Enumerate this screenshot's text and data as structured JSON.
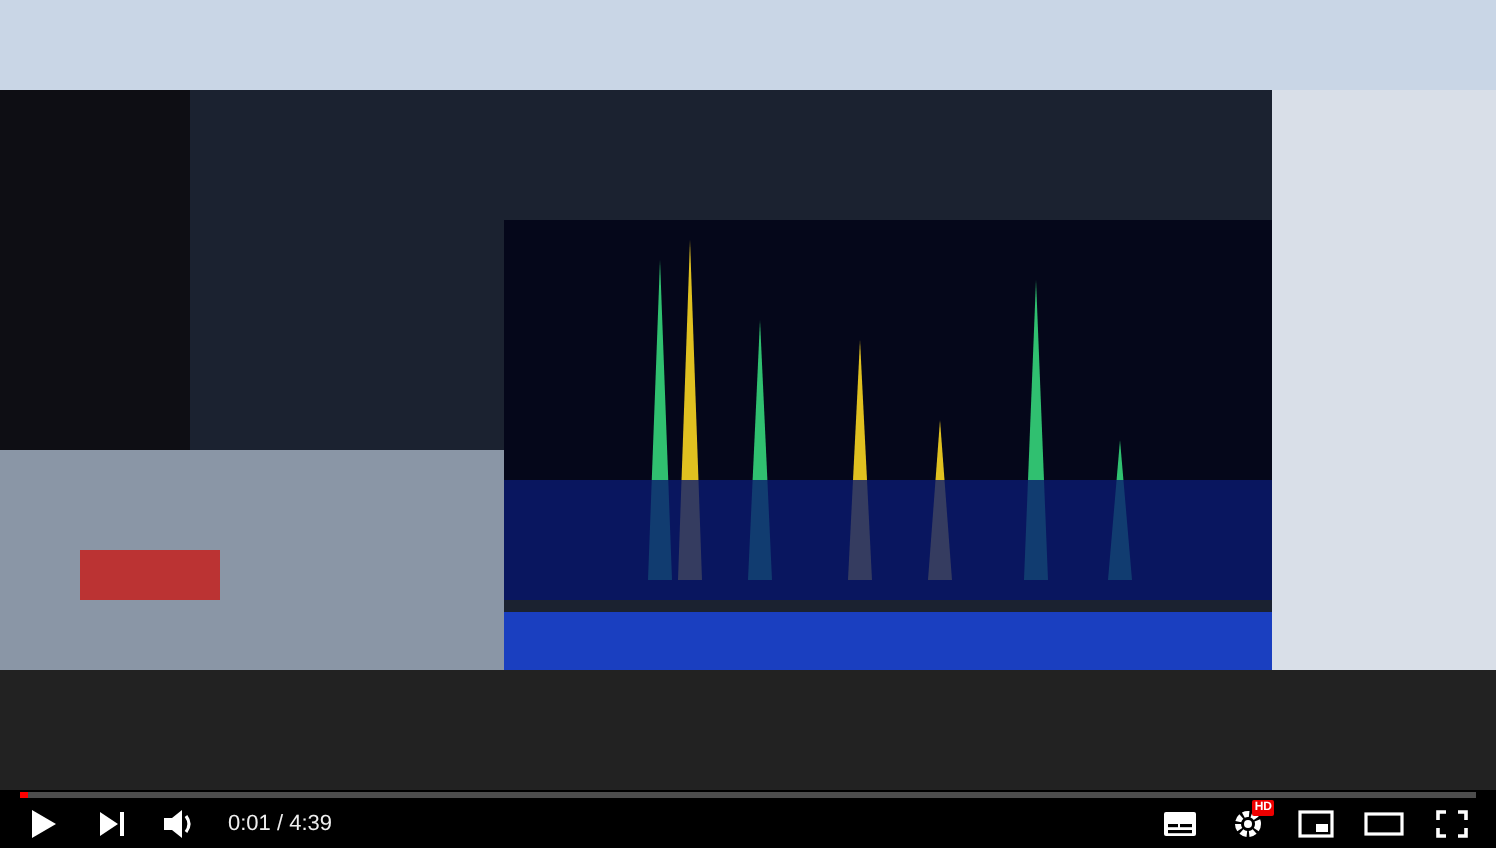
{
  "player": {
    "progress": {
      "level": 0.004
    },
    "time": "0:01 / 4:39",
    "settings_badge": "HD"
  }
}
